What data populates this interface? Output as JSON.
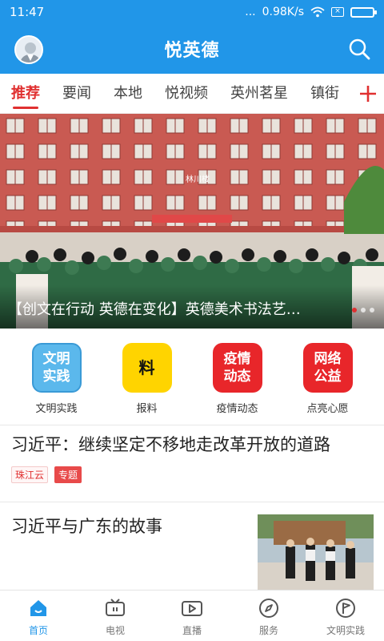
{
  "status_bar": {
    "time": "11:47",
    "dots": "...",
    "network_speed": "0.98K/s"
  },
  "header": {
    "title": "悦英德"
  },
  "tabs": [
    {
      "label": "推荐",
      "active": true
    },
    {
      "label": "要闻",
      "active": false
    },
    {
      "label": "本地",
      "active": false
    },
    {
      "label": "悦视频",
      "active": false
    },
    {
      "label": "英州茗星",
      "active": false
    },
    {
      "label": "镇街",
      "active": false
    }
  ],
  "banner": {
    "caption": "【创文在行动 英德在变化】英德美术书法艺…",
    "slide_index": 1,
    "slide_count": 3,
    "building_sign": "林川楼"
  },
  "quick_links": [
    {
      "icon_text": "文明\n实践",
      "label": "文明实践",
      "bg": "#5bb8ec",
      "fg": "#ffffff"
    },
    {
      "icon_text": "料",
      "label": "报料",
      "bg": "#ffd400",
      "fg": "#111111"
    },
    {
      "icon_text": "疫情\n动态",
      "label": "疫情动态",
      "bg": "#e8262a",
      "fg": "#ffffff"
    },
    {
      "icon_text": "网络\n公益",
      "label": "点亮心愿",
      "bg": "#e8262a",
      "fg": "#ffffff"
    }
  ],
  "news": [
    {
      "title": "习近平：继续坚定不移地走改革开放的道路",
      "tags": [
        "珠江云",
        "专题"
      ]
    },
    {
      "title": "习近平与广东的故事"
    }
  ],
  "bottom_nav": [
    {
      "label": "首页",
      "icon": "home-icon",
      "active": true
    },
    {
      "label": "电视",
      "icon": "tv-icon",
      "active": false
    },
    {
      "label": "直播",
      "icon": "live-icon",
      "active": false
    },
    {
      "label": "服务",
      "icon": "compass-icon",
      "active": false
    },
    {
      "label": "文明实践",
      "icon": "flag-icon",
      "active": false
    }
  ],
  "colors": {
    "brand": "#2196e8",
    "accent": "#e03030"
  }
}
